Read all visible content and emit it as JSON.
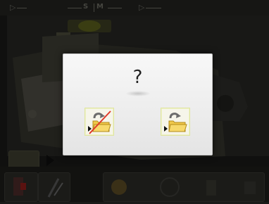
{
  "statusbar": {
    "s_label": "S",
    "m_label": "M"
  },
  "dialog": {
    "question": "?",
    "no_icon": "folder-load-cancel-icon",
    "yes_icon": "folder-load-icon"
  },
  "colors": {
    "dialog_bg": "#efefef",
    "button_border": "#dfe5a0",
    "cancel_slash": "#e03a2a",
    "folder": "#f0c84a"
  }
}
